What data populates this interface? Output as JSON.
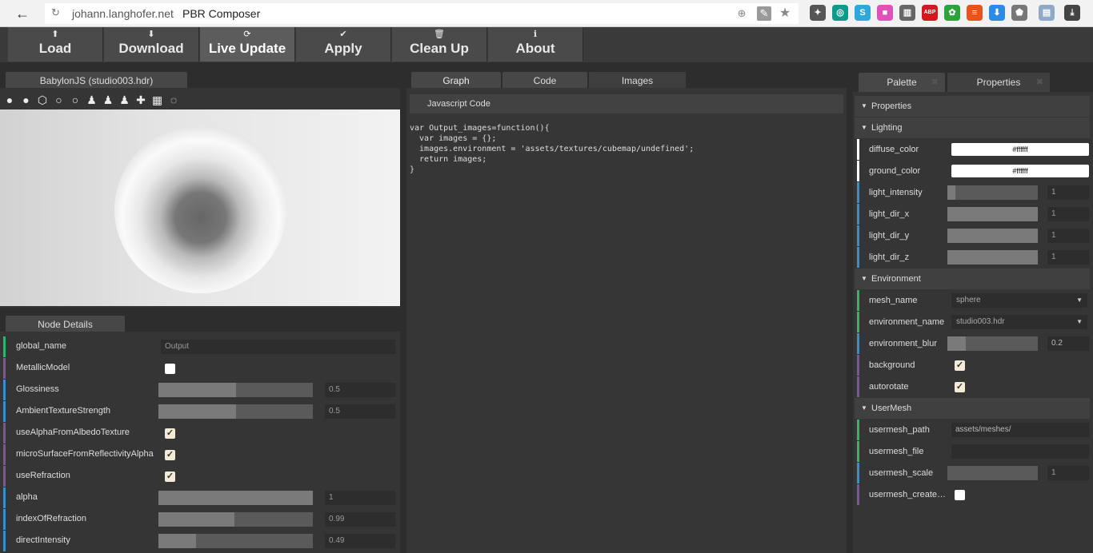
{
  "browser": {
    "url": "johann.langhofer.net",
    "title": "PBR Composer",
    "extensions": [
      {
        "name": "lightbulb-icon",
        "color": "#555",
        "glyph": "✦"
      },
      {
        "name": "search-extension-icon",
        "color": "#0a9b8a",
        "glyph": "◎"
      },
      {
        "name": "skype-icon",
        "color": "#2ea7d9",
        "glyph": "S"
      },
      {
        "name": "gradient-extension-icon",
        "color": "#e052b8",
        "glyph": "■"
      },
      {
        "name": "trash-icon",
        "color": "#666",
        "glyph": "▥"
      },
      {
        "name": "abp-icon",
        "color": "#d3191f",
        "glyph": "ABP"
      },
      {
        "name": "evernote-icon",
        "color": "#2ca33b",
        "glyph": "✿"
      },
      {
        "name": "bookmark-extension-icon",
        "color": "#e6541c",
        "glyph": "≡"
      },
      {
        "name": "download-extension-icon",
        "color": "#2d8be6",
        "glyph": "⬇"
      },
      {
        "name": "map-pin-icon",
        "color": "#777",
        "glyph": "⬟"
      },
      {
        "name": "document-icon",
        "color": "#8fa9c8",
        "glyph": "▤"
      },
      {
        "name": "downloads-icon",
        "color": "#444",
        "glyph": "⤓"
      }
    ]
  },
  "toolbar": {
    "buttons": [
      {
        "label": "Load",
        "icon": "⬆"
      },
      {
        "label": "Download",
        "icon": "⬇"
      },
      {
        "label": "Live Update",
        "icon": "⟳"
      },
      {
        "label": "Apply",
        "icon": "✔"
      },
      {
        "label": "Clean Up",
        "icon": "🗑"
      },
      {
        "label": "About",
        "icon": "ℹ"
      }
    ]
  },
  "viewer": {
    "tab": "BabylonJS (studio003.hdr)",
    "icons": [
      "●",
      "●",
      "⬡",
      "○",
      "○",
      "♟",
      "♟",
      "♟",
      "✚",
      "▦",
      "◌"
    ]
  },
  "node_details": {
    "tab": "Node Details",
    "global_name_label": "global_name",
    "global_name_value": "Output",
    "rows": [
      {
        "label": "MetallicModel",
        "type": "check",
        "checked": false,
        "bar": "#7a5a8a"
      },
      {
        "label": "Glossiness",
        "type": "slider",
        "fraction": 0.5,
        "value": "0.5",
        "bar": "#3a8fc8"
      },
      {
        "label": "AmbientTextureStrength",
        "type": "slider",
        "fraction": 0.5,
        "value": "0.5",
        "bar": "#3a8fc8"
      },
      {
        "label": "useAlphaFromAlbedoTexture",
        "type": "check",
        "checked": true,
        "bar": "#7a5a8a"
      },
      {
        "label": "microSurfaceFromReflectivityAlpha",
        "type": "check",
        "checked": true,
        "bar": "#7a5a8a"
      },
      {
        "label": "useRefraction",
        "type": "check",
        "checked": true,
        "bar": "#7a5a8a"
      },
      {
        "label": "alpha",
        "type": "slider",
        "fraction": 1.0,
        "value": "1",
        "bar": "#3a8fc8"
      },
      {
        "label": "indexOfRefraction",
        "type": "slider",
        "fraction": 0.49,
        "value": "0.99",
        "bar": "#3a8fc8"
      },
      {
        "label": "directIntensity",
        "type": "slider",
        "fraction": 0.245,
        "value": "0.49",
        "bar": "#3a8fc8"
      }
    ]
  },
  "middle": {
    "tabs": [
      "Graph",
      "Code",
      "Images"
    ],
    "header": "Javascript Code",
    "code": "var Output_images=function(){\n  var images = {};\n  images.environment = 'assets/textures/cubemap/undefined';\n  return images;\n}"
  },
  "right": {
    "tabs": [
      "Palette",
      "Properties"
    ],
    "sections": {
      "properties": "Properties",
      "lighting": "Lighting",
      "environment": "Environment",
      "usermesh": "UserMesh"
    },
    "lighting": {
      "diffuse_color_label": "diffuse_color",
      "diffuse_color": "#ffffff",
      "ground_color_label": "ground_color",
      "ground_color": "#ffffff",
      "sliders": [
        {
          "label": "light_intensity",
          "fraction": 0.09,
          "value": "1"
        },
        {
          "label": "light_dir_x",
          "fraction": 1.0,
          "value": "1"
        },
        {
          "label": "light_dir_y",
          "fraction": 1.0,
          "value": "1"
        },
        {
          "label": "light_dir_z",
          "fraction": 1.0,
          "value": "1"
        }
      ]
    },
    "environment": {
      "mesh_name_label": "mesh_name",
      "mesh_name": "sphere",
      "environment_name_label": "environment_name",
      "environment_name": "studio003.hdr",
      "environment_blur_label": "environment_blur",
      "environment_blur": "0.2",
      "environment_blur_fraction": 0.2,
      "background_label": "background",
      "autorotate_label": "autorotate"
    },
    "usermesh": {
      "path_label": "usermesh_path",
      "path": "assets/meshes/",
      "file_label": "usermesh_file",
      "file": "",
      "scale_label": "usermesh_scale",
      "scale": "1",
      "created_label": "usermesh_create…"
    }
  }
}
